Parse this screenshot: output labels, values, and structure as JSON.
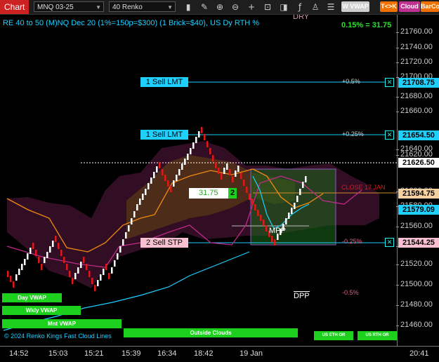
{
  "toolbar": {
    "chart_tab": "Chart",
    "instrument": "MNQ 03-25",
    "bar_type": "40 Renko",
    "icons": [
      "bar-chart-icon",
      "pencil-icon",
      "zoom-in-icon",
      "zoom-out-icon",
      "crosshair-icon",
      "lock-icon",
      "screenshot-icon",
      "indicators-icon",
      "strategy-icon",
      "data-box-icon"
    ],
    "buttons": [
      {
        "label": "W VWAP",
        "bg": "#cfcfcf",
        "fg": "#fff"
      },
      {
        "label": "T<>K",
        "bg": "#f07000",
        "fg": "#fff"
      },
      {
        "label": "Cloud",
        "bg": "#c03090",
        "fg": "#fff"
      },
      {
        "label": "BarCo",
        "bg": "#f07000",
        "fg": "#fff"
      }
    ]
  },
  "chart": {
    "title": "RE 40 to 50 (M)NQ Dec 20 (1%=150p=$300) (1 Brick=$40), US Dy RTH %",
    "top_right_pct": "0.15% = 31.75",
    "dry_label": "DRY",
    "mpp_label": "MPP",
    "dpp_label": "DPP",
    "close_label": "CLOSE 17 JAN",
    "copyright": "© 2024 Renko Kings Fast Cloud Lines",
    "position_pnl": "31.75",
    "position_qty": "2",
    "colors": {
      "up": "#ffffff",
      "down": "#e01818",
      "cyan": "#1fd0ff",
      "orange": "#f08a10",
      "magenta": "#c02a8a",
      "green": "#2ee02e"
    }
  },
  "orders": [
    {
      "label": "1 Sell LMT",
      "pct": "+0.5%",
      "price": "21708.75",
      "kind": "limit"
    },
    {
      "label": "1 Sell LMT",
      "pct": "+0.25%",
      "price": "21654.50",
      "kind": "limit"
    },
    {
      "label": "2 Sell STP",
      "pct": "-0.25%",
      "price": "21544.25",
      "kind": "stop"
    }
  ],
  "extra_pct": "-0.5%",
  "price_markers": [
    {
      "price": "21626.50",
      "kind": "last"
    },
    {
      "price": "21594.75",
      "kind": "close"
    },
    {
      "price": "21579.09",
      "kind": "cyan"
    }
  ],
  "y_axis": {
    "ticks": [
      "21760.00",
      "21740.00",
      "21720.00",
      "21700.00",
      "21680.00",
      "21660.00",
      "21640.00",
      "21620.00",
      "21600.00",
      "21580.00",
      "21560.00",
      "21540.00",
      "21520.00",
      "21500.00",
      "21480.00",
      "21460.00"
    ]
  },
  "x_axis": {
    "ticks": [
      "14:52",
      "15:03",
      "15:21",
      "15:39",
      "16:34",
      "18:42",
      "19 Jan",
      "20:41"
    ]
  },
  "vwap_labels": {
    "day": "Day VWAP",
    "wkly": "Wkly VWAP",
    "mnt": "Mnt VWAP",
    "outside": "Outside Clouds",
    "us_eth": "US ETH OR",
    "us_rth": "US RTH OR"
  }
}
